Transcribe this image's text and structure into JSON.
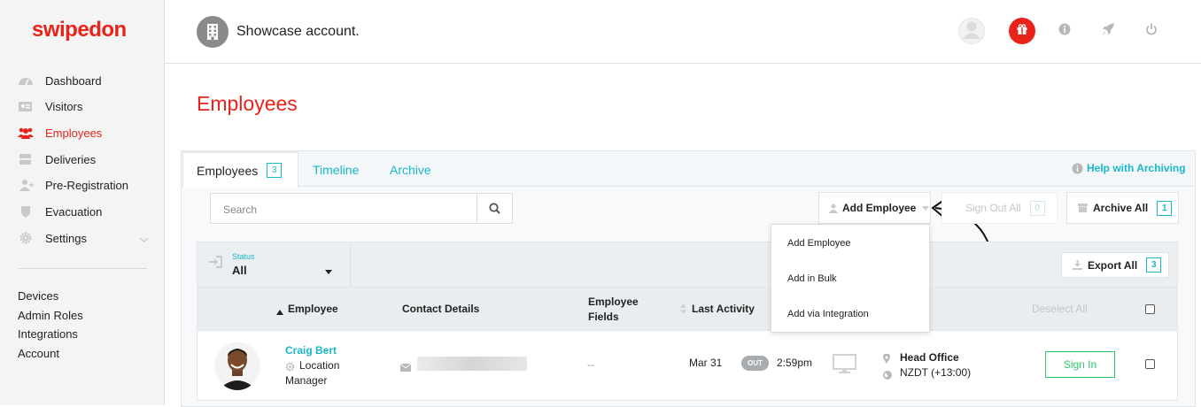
{
  "brand": {
    "logo": "swipedon",
    "accent": "#e8231a",
    "teal": "#19b8c8"
  },
  "sidebar": {
    "items": [
      {
        "label": "Dashboard",
        "icon": "dashboard-icon"
      },
      {
        "label": "Visitors",
        "icon": "visitor-card-icon"
      },
      {
        "label": "Employees",
        "icon": "employees-icon",
        "active": true
      },
      {
        "label": "Deliveries",
        "icon": "inbox-icon"
      },
      {
        "label": "Pre-Registration",
        "icon": "add-user-icon"
      },
      {
        "label": "Evacuation",
        "icon": "shield-icon"
      },
      {
        "label": "Settings",
        "icon": "gear-icon"
      }
    ],
    "links": [
      "Devices",
      "Admin Roles",
      "Integrations",
      "Account"
    ]
  },
  "header": {
    "account_name": "Showcase account."
  },
  "page": {
    "title": "Employees"
  },
  "tabs": [
    {
      "label": "Employees",
      "count": "3"
    },
    {
      "label": "Timeline"
    },
    {
      "label": "Archive"
    }
  ],
  "help_link": "Help with Archiving",
  "search": {
    "placeholder": "Search"
  },
  "buttons": {
    "add_employee": "Add Employee",
    "sign_out_all": "Sign Out All",
    "sign_out_count": "0",
    "archive_all": "Archive All",
    "archive_count": "1",
    "export_all": "Export All",
    "export_count": "3",
    "deselect_all": "Deselect All"
  },
  "add_menu": [
    "Add Employee",
    "Add in Bulk",
    "Add via Integration"
  ],
  "filter": {
    "label": "Status",
    "value": "All"
  },
  "columns": {
    "employee": "Employee",
    "contact": "Contact Details",
    "fields_line1": "Employee",
    "fields_line2": "Fields",
    "last_activity": "Last Activity"
  },
  "rows": [
    {
      "name": "Craig Bert",
      "role_line1": "Location",
      "role_line2": "Manager",
      "fields": "--",
      "date": "Mar 31",
      "status": "OUT",
      "time": "2:59pm",
      "location": "Head Office",
      "timezone": "NZDT (+13:00)",
      "action": "Sign In"
    }
  ]
}
